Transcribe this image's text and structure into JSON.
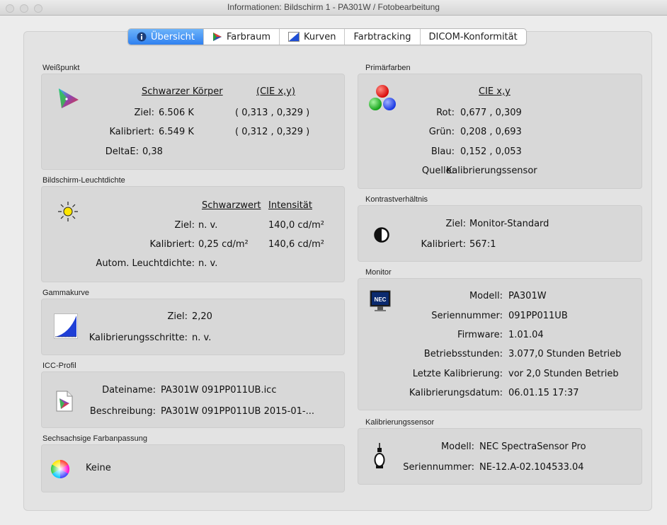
{
  "window": {
    "title": "Informationen: Bildschirm 1 - PA301W / Fotobearbeitung"
  },
  "tabs": [
    {
      "label": "Übersicht",
      "icon": "info-icon",
      "active": true
    },
    {
      "label": "Farbraum",
      "icon": "color-space-icon"
    },
    {
      "label": "Kurven",
      "icon": "curves-icon"
    },
    {
      "label": "Farbtracking"
    },
    {
      "label": "DICOM-Konformität"
    }
  ],
  "weisspunkt": {
    "label": "Weißpunkt",
    "col1": "Schwarzer Körper",
    "col2": "(CIE x,y)",
    "ziel_label": "Ziel:",
    "ziel_k": "6.506 K",
    "ziel_xy": "( 0,313 , 0,329 )",
    "kal_label": "Kalibriert:",
    "kal_k": "6.549 K",
    "kal_xy": "( 0,312 , 0,329 )",
    "delta_label": "DeltaE:",
    "delta_value": "0,38"
  },
  "leuchtdichte": {
    "label": "Bildschirm-Leuchtdichte",
    "col1": "Schwarzwert",
    "col2": "Intensität",
    "ziel_label": "Ziel:",
    "ziel_schwarz": "n. v.",
    "ziel_int": "140,0 cd/m²",
    "kal_label": "Kalibriert:",
    "kal_schwarz": "0,25 cd/m²",
    "kal_int": "140,6 cd/m²",
    "autom_label": "Autom. Leuchtdichte:",
    "autom_value": "n. v."
  },
  "gamma": {
    "label": "Gammakurve",
    "ziel_label": "Ziel:",
    "ziel_value": "2,20",
    "schritte_label": "Kalibrierungsschritte:",
    "schritte_value": "n. v."
  },
  "icc": {
    "label": "ICC-Profil",
    "datei_label": "Dateiname:",
    "datei_value": "PA301W 091PP011UB.icc",
    "beschr_label": "Beschreibung:",
    "beschr_value": "PA301W 091PP011UB 2015-01-..."
  },
  "sechsachsig": {
    "label": "Sechsachsige Farbanpassung",
    "value": "Keine"
  },
  "primaer": {
    "label": "Primärfarben",
    "col": "CIE x,y",
    "rot_label": "Rot:",
    "rot_value": "0,677 , 0,309",
    "gruen_label": "Grün:",
    "gruen_value": "0,208 , 0,693",
    "blau_label": "Blau:",
    "blau_value": "0,152 , 0,053",
    "quelle_label": "Quelle:",
    "quelle_value": "Kalibrierungssensor"
  },
  "kontrast": {
    "label": "Kontrastverhältnis",
    "ziel_label": "Ziel:",
    "ziel_value": "Monitor-Standard",
    "kal_label": "Kalibriert:",
    "kal_value": "567:1"
  },
  "monitor": {
    "label": "Monitor",
    "logo_text": "NEC",
    "modell_label": "Modell:",
    "modell_value": "PA301W",
    "serien_label": "Seriennummer:",
    "serien_value": "091PP011UB",
    "firmware_label": "Firmware:",
    "firmware_value": "1.01.04",
    "betrieb_label": "Betriebsstunden:",
    "betrieb_value": "3.077,0 Stunden Betrieb",
    "letzte_label": "Letzte Kalibrierung:",
    "letzte_value": "vor 2,0 Stunden Betrieb",
    "datum_label": "Kalibrierungsdatum:",
    "datum_value": "06.01.15 17:37"
  },
  "sensor": {
    "label": "Kalibrierungssensor",
    "modell_label": "Modell:",
    "modell_value": "NEC SpectraSensor Pro",
    "serien_label": "Seriennummer:",
    "serien_value": "NE-12.A-02.104533.04"
  },
  "colors": {
    "accent": "#2f80f0",
    "panel": "#d8d8d8",
    "background": "#ececec"
  }
}
